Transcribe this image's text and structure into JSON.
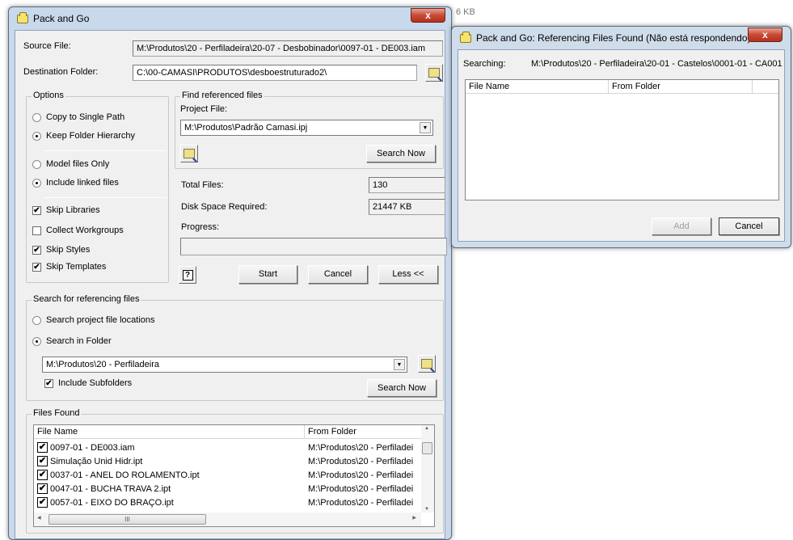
{
  "background": {
    "fragment_text": "6 KB"
  },
  "main_dialog": {
    "title": "Pack and Go",
    "close_label": "x",
    "source_file_label": "Source File:",
    "source_file_value": "M:\\Produtos\\20 - Perfiladeira\\20-07 - Desbobinador\\0097-01 - DE003.iam",
    "destination_folder_label": "Destination Folder:",
    "destination_folder_value": "C:\\00-CAMASI\\PRODUTOS\\desboestruturado2\\",
    "options": {
      "title": "Options",
      "copy_single_path": {
        "label": "Copy to Single Path",
        "selected": false
      },
      "keep_folder_hierarchy": {
        "label": "Keep Folder Hierarchy",
        "selected": true
      },
      "model_files_only": {
        "label": "Model files Only",
        "selected": false
      },
      "include_linked_files": {
        "label": "Include linked files",
        "selected": true
      },
      "skip_libraries": {
        "label": "Skip Libraries",
        "checked": true
      },
      "collect_workgroups": {
        "label": "Collect Workgroups",
        "checked": false
      },
      "skip_styles": {
        "label": "Skip Styles",
        "checked": true
      },
      "skip_templates": {
        "label": "Skip Templates",
        "checked": true
      }
    },
    "find_referenced": {
      "title": "Find referenced files",
      "project_file_label": "Project File:",
      "project_file_value": "M:\\Produtos\\Padrão Camasi.ipj",
      "search_now_label": "Search Now"
    },
    "stats": {
      "total_files_label": "Total Files:",
      "total_files_value": "130",
      "disk_space_label": "Disk Space Required:",
      "disk_space_value": "21447 KB",
      "progress_label": "Progress:",
      "progress_percent": 0
    },
    "buttons": {
      "help": "?",
      "start": "Start",
      "cancel": "Cancel",
      "less": "Less <<"
    },
    "search_referencing": {
      "title": "Search for referencing files",
      "search_project_locations": {
        "label": "Search project file locations",
        "selected": false
      },
      "search_in_folder": {
        "label": "Search in Folder",
        "selected": true
      },
      "folder_value": "M:\\Produtos\\20 - Perfiladeira",
      "include_subfolders": {
        "label": "Include Subfolders",
        "checked": true
      },
      "search_now_label": "Search Now"
    },
    "files_found": {
      "title": "Files Found",
      "columns": [
        "File Name",
        "From Folder"
      ],
      "rows": [
        {
          "name": "0097-01 - DE003.iam",
          "folder": "M:\\Produtos\\20 - Perfiladei",
          "checked": true
        },
        {
          "name": "Simulação Unid Hidr.ipt",
          "folder": "M:\\Produtos\\20 - Perfiladei",
          "checked": true
        },
        {
          "name": "0037-01 - ANEL DO ROLAMENTO.ipt",
          "folder": "M:\\Produtos\\20 - Perfiladei",
          "checked": true
        },
        {
          "name": "0047-01 - BUCHA TRAVA 2.ipt",
          "folder": "M:\\Produtos\\20 - Perfiladei",
          "checked": true
        },
        {
          "name": "0057-01 - EIXO DO BRAÇO.ipt",
          "folder": "M:\\Produtos\\20 - Perfiladei",
          "checked": true
        }
      ],
      "hscroll_grip": "III"
    }
  },
  "ref_dialog": {
    "title": "Pack and Go: Referencing Files Found (Não está respondendo)",
    "close_label": "x",
    "searching_label": "Searching:",
    "searching_value": "M:\\Produtos\\20 - Perfiladeira\\20-01 - Castelos\\0001-01 - CA001",
    "columns": [
      "File Name",
      "From Folder"
    ],
    "add_label": "Add",
    "cancel_label": "Cancel"
  },
  "icons": {
    "check": "✔",
    "dropdown": "▼",
    "up": "▲",
    "down": "▼",
    "left": "◀",
    "right": "▶"
  }
}
